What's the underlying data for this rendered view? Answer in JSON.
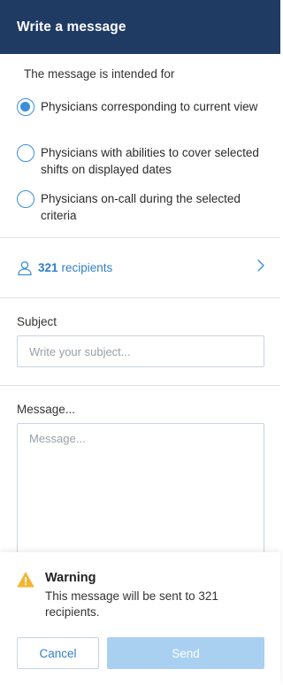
{
  "header": {
    "title": "Write a message"
  },
  "intended": {
    "label": "The message is intended for",
    "options": [
      {
        "label": "Physicians corresponding to current view",
        "checked": true
      },
      {
        "label": "Physicians with abilities to cover selected shifts on displayed dates",
        "checked": false
      },
      {
        "label": "Physicians on-call during the selected criteria",
        "checked": false
      }
    ]
  },
  "recipients": {
    "count": "321",
    "label": "recipients",
    "icon": "person-icon"
  },
  "subject": {
    "label": "Subject",
    "placeholder": "Write your subject...",
    "value": ""
  },
  "message": {
    "label": "Message...",
    "placeholder": "Message...",
    "value": ""
  },
  "warning": {
    "icon": "warning-icon",
    "title": "Warning",
    "text": "This message will be sent to 321 recipients."
  },
  "actions": {
    "cancel_label": "Cancel",
    "send_label": "Send"
  },
  "colors": {
    "header": "#1f3a63",
    "accent": "#3a8fd9",
    "link": "#2f7fc8",
    "send_disabled": "#a9d0f0",
    "warning": "#f2b632"
  }
}
